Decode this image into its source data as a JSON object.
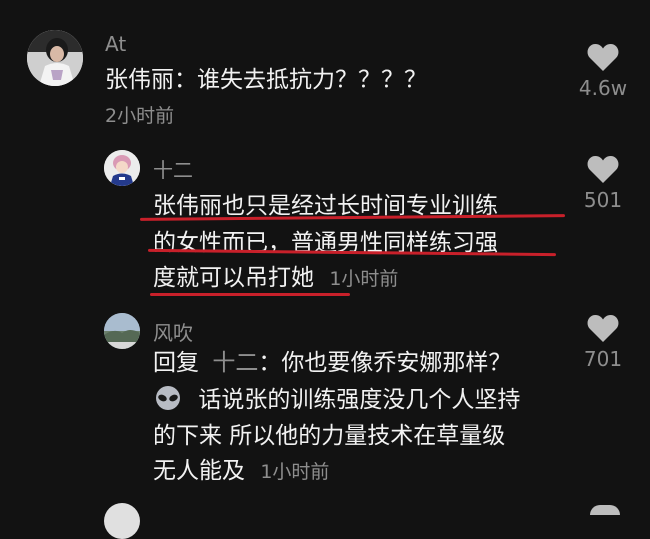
{
  "comments": [
    {
      "author": "At",
      "text": "张伟丽：谁失去抵抗力？？？？",
      "time": "2小时前",
      "likes": "4.6w",
      "avatar_icon": "user-avatar-photo"
    },
    {
      "author": "十二",
      "lines": [
        "张伟丽也只是经过长时间专业训练",
        "的女性而已，普通男性同样练习强",
        "度就可以吊打她"
      ],
      "time": "1小时前",
      "likes": "501",
      "avatar_icon": "user-avatar-illustration",
      "annotation_color": "#c8202a"
    },
    {
      "author": "风吹",
      "reply_label": "回复",
      "reply_to": "十二",
      "reply_text": "：你也要像乔安娜那样？",
      "emoji_icon": "alien-emoji-icon",
      "lines": [
        "话说张的训练强度没几个人坚持",
        "的下来 所以他的力量技术在草量级",
        "无人能及"
      ],
      "time": "1小时前",
      "likes": "701",
      "avatar_icon": "user-avatar-landscape"
    }
  ],
  "colors": {
    "background": "#121212",
    "primary_text": "#f2f2f2",
    "secondary_text": "#8e8e8e",
    "like_icon": "#bdbdbd",
    "annotation": "#c8202a"
  }
}
